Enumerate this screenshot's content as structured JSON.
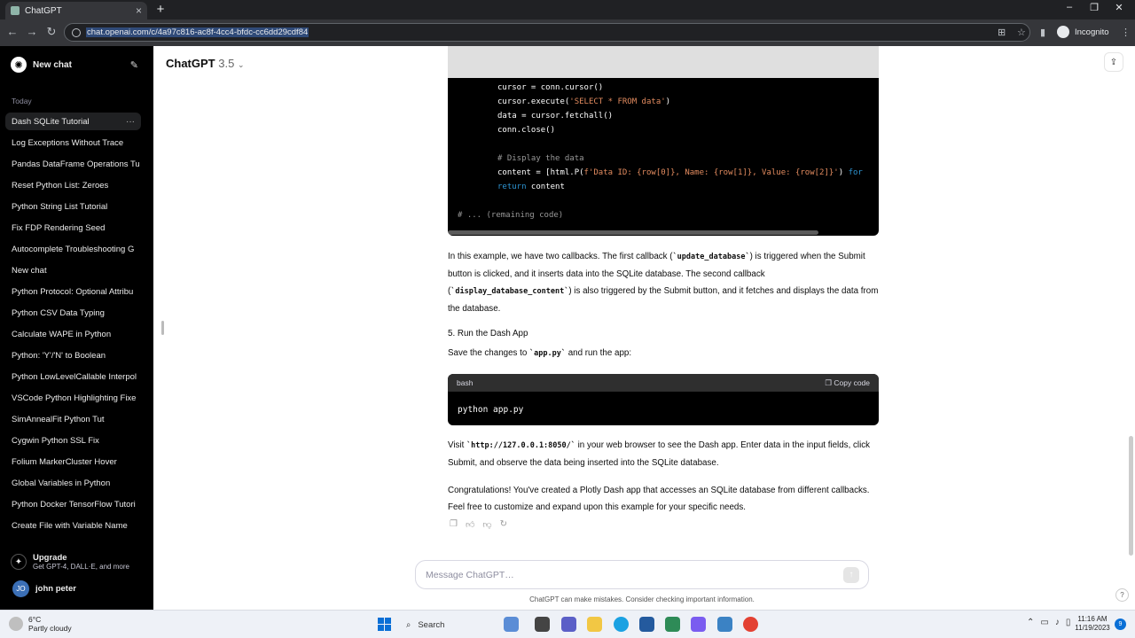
{
  "browser": {
    "tab_title": "ChatGPT",
    "url": "chat.openai.com/c/4a97c816-ac8f-4cc4-bfdc-cc6dd29cdf84",
    "incognito_label": "Incognito"
  },
  "sidebar": {
    "new_chat": "New chat",
    "section_today": "Today",
    "items": [
      {
        "label": "Dash SQLite Tutorial"
      },
      {
        "label": "Log Exceptions Without Trace"
      },
      {
        "label": "Pandas DataFrame Operations Tu"
      },
      {
        "label": "Reset Python List: Zeroes"
      },
      {
        "label": "Python String List Tutorial"
      },
      {
        "label": "Fix FDP Rendering Seed"
      },
      {
        "label": "Autocomplete Troubleshooting G"
      },
      {
        "label": "New chat"
      },
      {
        "label": "Python Protocol: Optional Attribu"
      },
      {
        "label": "Python CSV Data Typing"
      },
      {
        "label": "Calculate WAPE in Python"
      },
      {
        "label": "Python: 'Y'/'N' to Boolean"
      },
      {
        "label": "Python LowLevelCallable Interpol"
      },
      {
        "label": "VSCode Python Highlighting Fixe"
      },
      {
        "label": "SimAnnealFit Python Tut"
      },
      {
        "label": "Cygwin Python SSL Fix"
      },
      {
        "label": "Folium MarkerCluster Hover"
      },
      {
        "label": "Global Variables in Python"
      },
      {
        "label": "Python Docker TensorFlow Tutori"
      },
      {
        "label": "Create File with Variable Name"
      }
    ],
    "upgrade_title": "Upgrade",
    "upgrade_sub": "Get GPT-4, DALL·E, and more",
    "user_initials": "JO",
    "user_name": "john peter"
  },
  "header": {
    "model_name": "ChatGPT",
    "model_version": "3.5"
  },
  "code_block_1": {
    "lines": [
      {
        "t": "cursor = conn.cursor()"
      },
      {
        "t": "cursor.execute(",
        "s": "'SELECT * FROM data'",
        "e": ")"
      },
      {
        "t": "data = cursor.fetchall()"
      },
      {
        "t": "conn.close()"
      },
      {
        "c": "# Display the data"
      },
      {
        "t": "content = [html.P(",
        "s": "f'Data ID: {row[0]}, Name: {row[1]}, Value: {row[2]}'",
        "e": ") ",
        "k": "for"
      },
      {
        "k": "return",
        "e": " content"
      },
      {
        "c": "# ... (remaining code)"
      }
    ]
  },
  "paragraphs": {
    "p1_a": "In this example, we have two callbacks. The first callback (",
    "p1_code1": "`update_database`",
    "p1_b": ") is triggered when the Submit button is clicked, and it inserts data into the SQLite database. The second callback (",
    "p1_code2": "`display_database_content`",
    "p1_c": ") is also triggered by the Submit button, and it fetches and displays the data from the database.",
    "step5": "5. Run the Dash App",
    "save_a": "Save the changes to ",
    "save_code": "`app.py`",
    "save_b": " and run the app:",
    "visit_a": "Visit ",
    "visit_code": "`http://127.0.0.1:8050/`",
    "visit_b": " in your web browser to see the Dash app. Enter data in the input fields, click Submit, and observe the data being inserted into the SQLite database.",
    "congrats": "Congratulations! You've created a Plotly Dash app that accesses an SQLite database from different callbacks. Feel free to customize and expand upon this example for your specific needs."
  },
  "code_block_2": {
    "lang": "bash",
    "copy_label": "Copy code",
    "code": "python app.py"
  },
  "composer": {
    "placeholder": "Message ChatGPT…",
    "disclaimer": "ChatGPT can make mistakes. Consider checking important information."
  },
  "taskbar": {
    "temp": "6°C",
    "weather": "Partly cloudy",
    "search": "Search",
    "time": "11:16 AM",
    "date": "11/19/2023",
    "notif_count": "9"
  }
}
